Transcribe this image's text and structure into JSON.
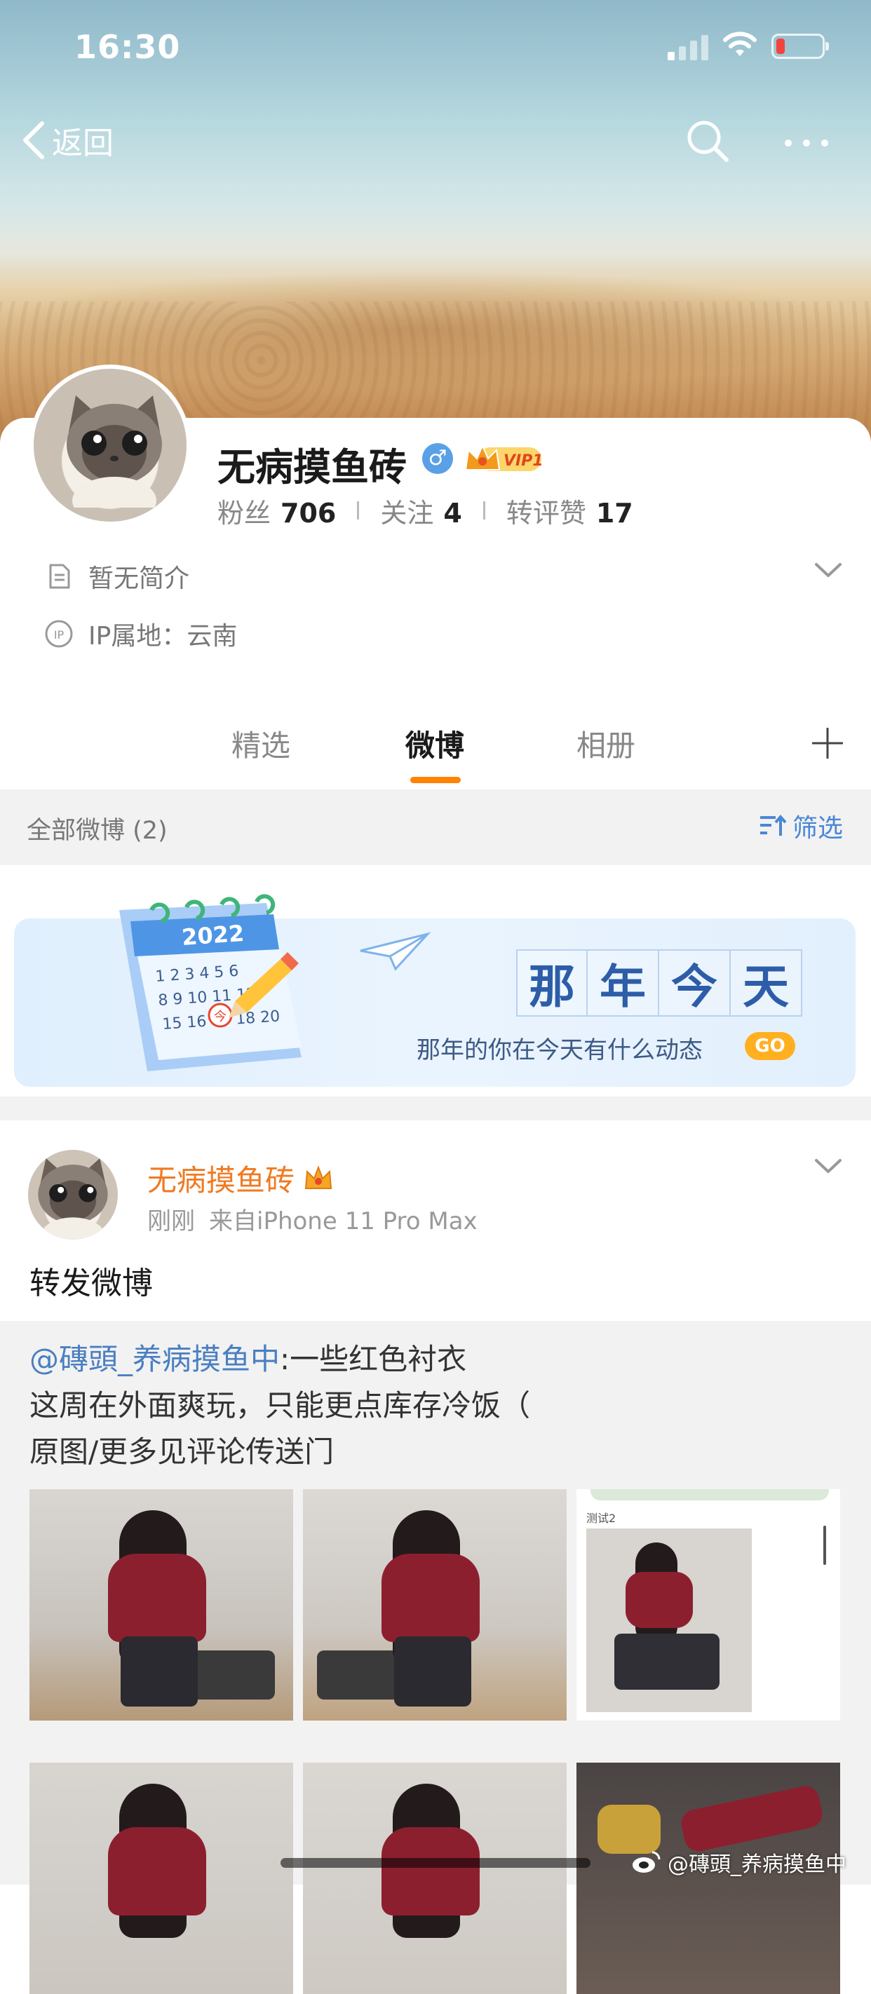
{
  "status_bar": {
    "time": "16:30"
  },
  "nav": {
    "back_label": "返回"
  },
  "profile": {
    "name": "无病摸鱼砖",
    "gender_symbol": "♂",
    "vip_label": "VIP1",
    "stats": [
      {
        "label": "粉丝",
        "value": "706"
      },
      {
        "label": "关注",
        "value": "4"
      },
      {
        "label": "转评赞",
        "value": "17"
      }
    ],
    "bio": "暂无简介",
    "ip": "IP属地：云南",
    "ip_icon_text": "IP"
  },
  "tabs": [
    {
      "label": "精选",
      "active": false
    },
    {
      "label": "微博",
      "active": true
    },
    {
      "label": "相册",
      "active": false
    }
  ],
  "filter": {
    "title": "全部微博 (2)",
    "button": "筛选"
  },
  "memory_banner": {
    "title_chars": [
      "那",
      "年",
      "今",
      "天"
    ],
    "subtitle": "那年的你在今天有什么动态",
    "go": "GO",
    "calendar_year": "2022",
    "calendar_rows": [
      "1 2 3 4 5 6",
      "8 9 10 11 12",
      "15 16 17 18 20"
    ],
    "today_badge": "今"
  },
  "post": {
    "author": "无病摸鱼砖",
    "time": "刚刚",
    "source": "来自iPhone 11 Pro Max",
    "text": "转发微博",
    "repost": {
      "mention": "@磚頭_养病摸鱼中",
      "line1_rest": ":一些红色衬衣",
      "line2": "这周在外面爽玩，只能更点库存冷饭（",
      "line3": "原图/更多见评论传送门"
    },
    "screenshot_tile_label": "测试2"
  },
  "watermark": "@磚頭_养病摸鱼中",
  "colors": {
    "accent_orange": "#ff8200",
    "link_blue": "#4a7fc1",
    "author_orange": "#f07a22",
    "gender_blue": "#5aa0e6",
    "vip_gold": "#f6c343"
  },
  "icons": [
    "back-chevron-icon",
    "search-icon",
    "more-dots-icon",
    "signal-icon",
    "wifi-icon",
    "battery-icon",
    "bio-doc-icon",
    "ip-location-icon",
    "chevron-down-icon",
    "plus-icon",
    "filter-sort-icon",
    "vip-crown-icon",
    "weibo-logo-icon"
  ]
}
